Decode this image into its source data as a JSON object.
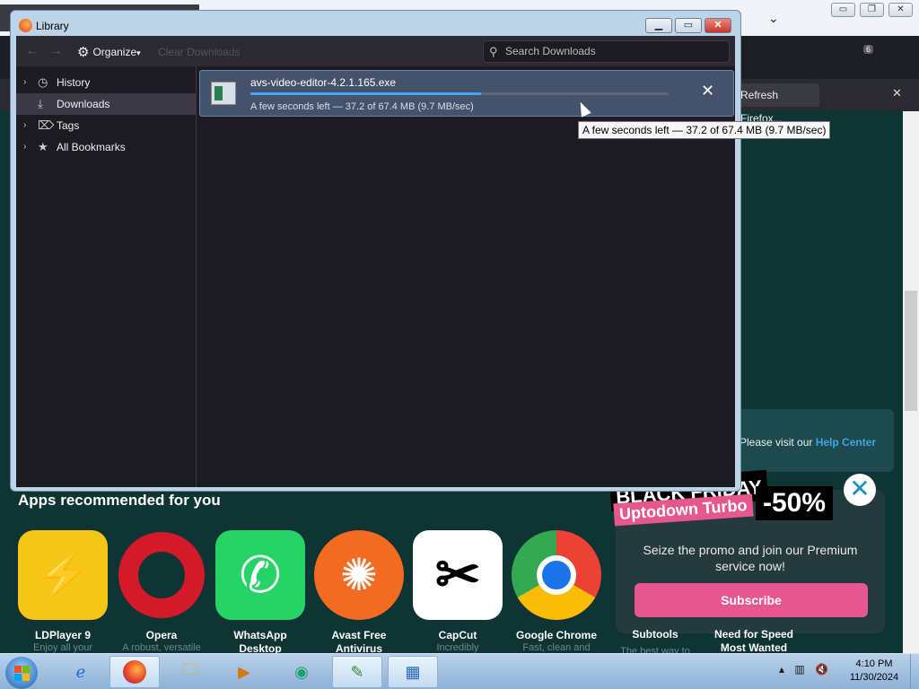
{
  "background_browser": {
    "notification_button": "Refresh Firefox...",
    "extension_badge": "6",
    "help_text": "Please visit our",
    "help_link": "Help Center"
  },
  "apps_section": {
    "title": "Apps recommended for you",
    "apps": [
      {
        "name": "LDPlayer 9",
        "sub": "Enjoy all your",
        "color": "#f5c518"
      },
      {
        "name": "Opera",
        "sub": "A robust, versatile",
        "color": "#d21a2a"
      },
      {
        "name": "WhatsApp Desktop",
        "sub": "",
        "color": "#25d366"
      },
      {
        "name": "Avast Free Antivirus",
        "sub": "",
        "color": "#f26b21"
      },
      {
        "name": "CapCut",
        "sub": "Incredibly",
        "color": "#ffffff"
      },
      {
        "name": "Google Chrome",
        "sub": "Fast, clean and",
        "color": "#1a73e8"
      }
    ],
    "partial_apps": [
      {
        "name": "Subtools",
        "sub": "The best way to"
      },
      {
        "name": "Need for Speed Most Wanted",
        "sub": ""
      }
    ]
  },
  "promo": {
    "badge_top": "BLACK FRIDAY",
    "badge_brand": "Uptodown Turbo",
    "discount": "-50%",
    "message": "Seize the promo and join our Premium service now!",
    "button": "Subscribe",
    "close": "✕",
    "accent": "#e5578d"
  },
  "library": {
    "title": "Library",
    "toolbar": {
      "organize": "Organize",
      "clear_downloads": "Clear Downloads",
      "search_placeholder": "Search Downloads"
    },
    "sidebar": [
      {
        "label": "History",
        "icon": "clock-icon"
      },
      {
        "label": "Downloads",
        "icon": "download-icon"
      },
      {
        "label": "Tags",
        "icon": "tag-icon"
      },
      {
        "label": "All Bookmarks",
        "icon": "star-icon"
      }
    ],
    "download": {
      "filename": "avs-video-editor-4.2.1.165.exe",
      "status": "A few seconds left — 37.2 of 67.4 MB (9.7 MB/sec)",
      "progress": 0.552
    },
    "tooltip": "A few seconds left — 37.2 of 67.4 MB (9.7 MB/sec)"
  },
  "taskbar": {
    "time": "4:10 PM",
    "date": "11/30/2024"
  }
}
